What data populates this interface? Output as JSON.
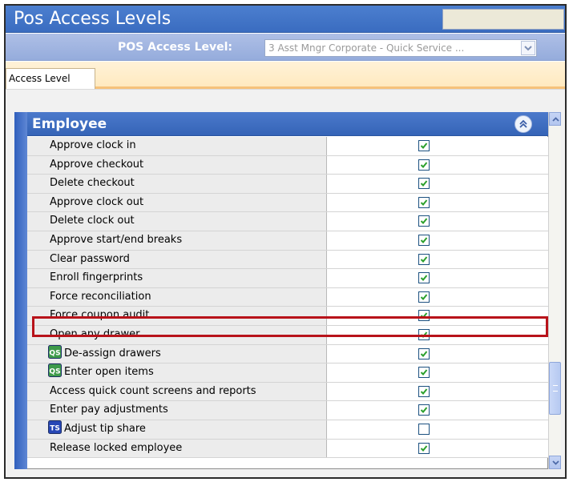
{
  "window": {
    "title": "Pos Access Levels"
  },
  "level_bar": {
    "label": "POS Access Level:",
    "selected_value": "3 Asst Mngr Corporate - Quick Service ..."
  },
  "tabs": [
    {
      "label": "Access Level"
    }
  ],
  "group": {
    "title": "Employee"
  },
  "rows": [
    {
      "label": "Approve clock in",
      "checked": true,
      "badge": ""
    },
    {
      "label": "Approve checkout",
      "checked": true,
      "badge": ""
    },
    {
      "label": "Delete checkout",
      "checked": true,
      "badge": ""
    },
    {
      "label": "Approve clock out",
      "checked": true,
      "badge": ""
    },
    {
      "label": "Delete clock out",
      "checked": true,
      "badge": ""
    },
    {
      "label": "Approve start/end breaks",
      "checked": true,
      "badge": ""
    },
    {
      "label": "Clear password",
      "checked": true,
      "badge": ""
    },
    {
      "label": "Enroll fingerprints",
      "checked": true,
      "badge": ""
    },
    {
      "label": "Force reconciliation",
      "checked": true,
      "badge": ""
    },
    {
      "label": "Force coupon audit",
      "checked": true,
      "badge": ""
    },
    {
      "label": "Open any drawer",
      "checked": true,
      "badge": ""
    },
    {
      "label": "De-assign drawers",
      "checked": true,
      "badge": "QS"
    },
    {
      "label": "Enter open items",
      "checked": true,
      "badge": "QS"
    },
    {
      "label": "Access quick count screens and reports",
      "checked": true,
      "badge": ""
    },
    {
      "label": "Enter pay adjustments",
      "checked": true,
      "badge": ""
    },
    {
      "label": "Adjust tip share",
      "checked": false,
      "badge": "TS"
    },
    {
      "label": "Release locked employee",
      "checked": true,
      "badge": ""
    }
  ],
  "highlighted_row": "Force coupon audit",
  "colors": {
    "accent_blue": "#3a6cc0",
    "highlight_red": "#b8131a",
    "check_green": "#2ca02c",
    "qs_badge": "#3e9a4a",
    "ts_badge": "#2747b5"
  }
}
